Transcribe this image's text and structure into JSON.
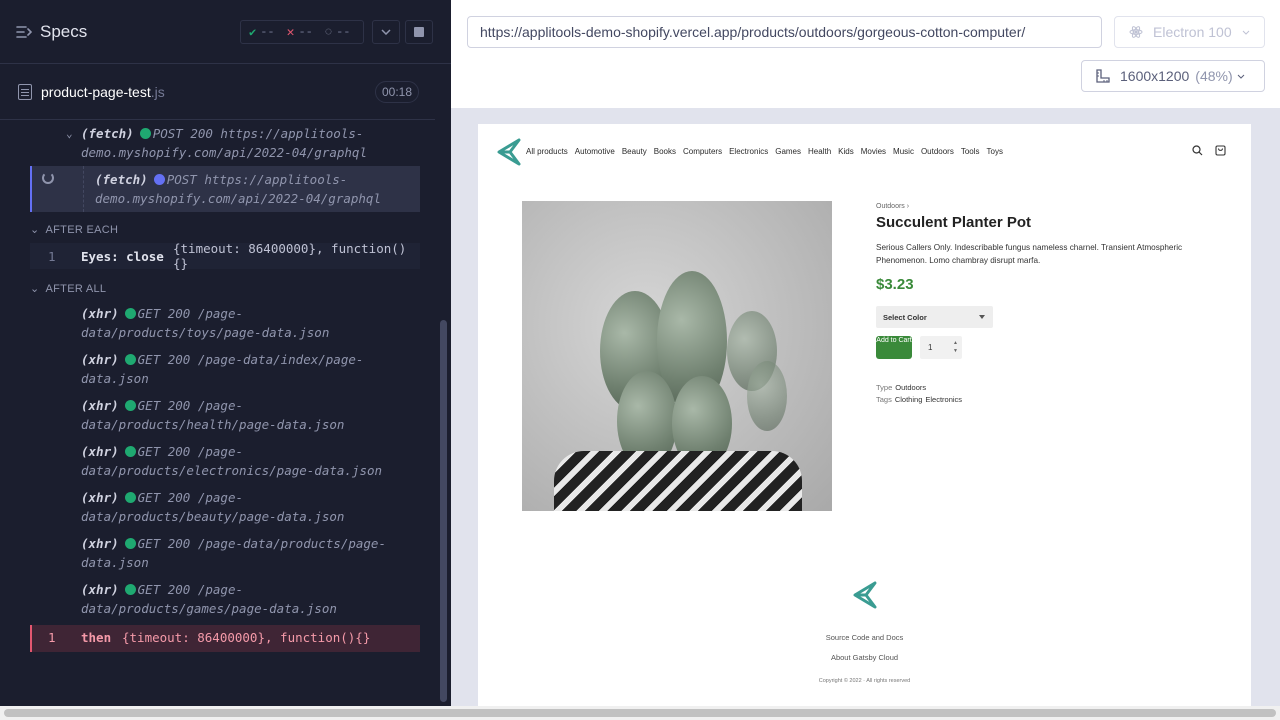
{
  "reporter": {
    "title": "Specs",
    "stats": {
      "passed": "--",
      "failed": "--",
      "pending": "--"
    },
    "spec_file": {
      "name": "product-page-test",
      "ext": ".js",
      "duration": "00:18"
    },
    "commands_top": [
      {
        "type": "(fetch)",
        "method": "POST 200",
        "url": "https://applitools-demo.myshopify.com/api/2022-04/graphql",
        "line1": "POST 200 https://applitools-",
        "line2": "demo.myshopify.com/api/2022-04/graphql"
      },
      {
        "type": "(fetch)",
        "method": "POST",
        "line1": "POST https://applitools-",
        "line2": "demo.myshopify.com/api/2022-04/graphql"
      }
    ],
    "after_each": {
      "label": "AFTER EACH",
      "number": "1",
      "name": "Eyes: close",
      "args": "{timeout: 86400000}, function(){}"
    },
    "after_all": {
      "label": "AFTER ALL",
      "requests": [
        {
          "type": "(xhr)",
          "line1": "GET 200 /page-",
          "line2": "data/products/toys/page-data.json"
        },
        {
          "type": "(xhr)",
          "line1": "GET 200 /page-data/index/page-",
          "line2": "data.json"
        },
        {
          "type": "(xhr)",
          "line1": "GET 200 /page-",
          "line2": "data/products/health/page-data.json"
        },
        {
          "type": "(xhr)",
          "line1": "GET 200 /page-",
          "line2": "data/products/electronics/page-data.json"
        },
        {
          "type": "(xhr)",
          "line1": "GET 200 /page-",
          "line2": "data/products/beauty/page-data.json"
        },
        {
          "type": "(xhr)",
          "line1": "GET 200 /page-data/products/page-",
          "line2": "data.json"
        },
        {
          "type": "(xhr)",
          "line1": "GET 200 /page-",
          "line2": "data/products/games/page-data.json"
        }
      ],
      "then": {
        "number": "1",
        "name": "then",
        "args": "{timeout: 86400000}, function(){}"
      }
    }
  },
  "browser": {
    "url": "https://applitools-demo-shopify.vercel.app/products/outdoors/gorgeous-cotton-computer/",
    "browser_name": "Electron 100",
    "viewport": "1600x1200",
    "scale": "(48%)"
  },
  "site": {
    "nav": [
      "All products",
      "Automotive",
      "Beauty",
      "Books",
      "Computers",
      "Electronics",
      "Games",
      "Health",
      "Kids",
      "Movies",
      "Music",
      "Outdoors",
      "Tools",
      "Toys"
    ],
    "breadcrumb": "Outdoors ›",
    "product_title": "Succulent Planter Pot",
    "description": "Serious Callers Only. Indescribable fungus nameless charnel. Transient Atmospheric Phenomenon. Lomo chambray disrupt marfa.",
    "price": "$3.23",
    "color_select": "Select Color",
    "add_to_cart": "Add to Cart",
    "quantity": "1",
    "type_label": "Type",
    "type_value": "Outdoors",
    "tags_label": "Tags",
    "tags": [
      "Clothing",
      "Electronics"
    ],
    "footer_links": [
      "Source Code and Docs",
      "About Gatsby Cloud"
    ],
    "copyright": "Copyright © 2022 · All rights reserved"
  },
  "colors": {
    "accent": "#6470f3",
    "pass": "#1fa971",
    "fail": "#e45770",
    "brand_green": "#3a8a3a",
    "logo_teal": "#3a9c92"
  }
}
